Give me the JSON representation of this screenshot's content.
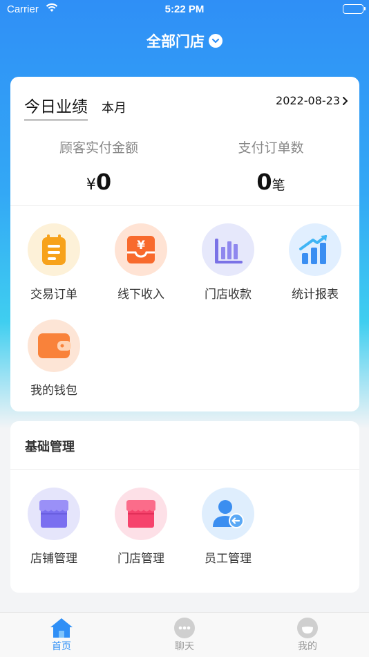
{
  "status_bar": {
    "carrier": "Carrier",
    "time": "5:22 PM"
  },
  "header": {
    "store_selector": "全部门店"
  },
  "performance": {
    "tab_today": "今日业绩",
    "tab_month": "本月",
    "date": "2022-08-23",
    "metrics": [
      {
        "label": "顾客实付金额",
        "prefix": "¥",
        "value": "0"
      },
      {
        "label": "支付订单数",
        "value": "0",
        "unit": "笔"
      }
    ],
    "shortcuts": [
      {
        "label": "交易订单",
        "icon": "clipboard-icon"
      },
      {
        "label": "线下收入",
        "icon": "yen-drawer-icon"
      },
      {
        "label": "门店收款",
        "icon": "bar-chart-icon"
      },
      {
        "label": "统计报表",
        "icon": "growth-chart-icon"
      },
      {
        "label": "我的钱包",
        "icon": "wallet-icon"
      }
    ]
  },
  "management": {
    "title": "基础管理",
    "items": [
      {
        "label": "店铺管理",
        "icon": "shop-icon"
      },
      {
        "label": "门店管理",
        "icon": "store-icon"
      },
      {
        "label": "员工管理",
        "icon": "staff-icon"
      }
    ]
  },
  "tabbar": {
    "items": [
      {
        "label": "首页",
        "icon": "home-icon",
        "active": true
      },
      {
        "label": "聊天",
        "icon": "chat-icon"
      },
      {
        "label": "我的",
        "icon": "profile-icon"
      }
    ]
  },
  "colors": {
    "primary": "#2f8ff6",
    "gradient_end": "#3fcef0",
    "background": "#f3f4f6"
  }
}
